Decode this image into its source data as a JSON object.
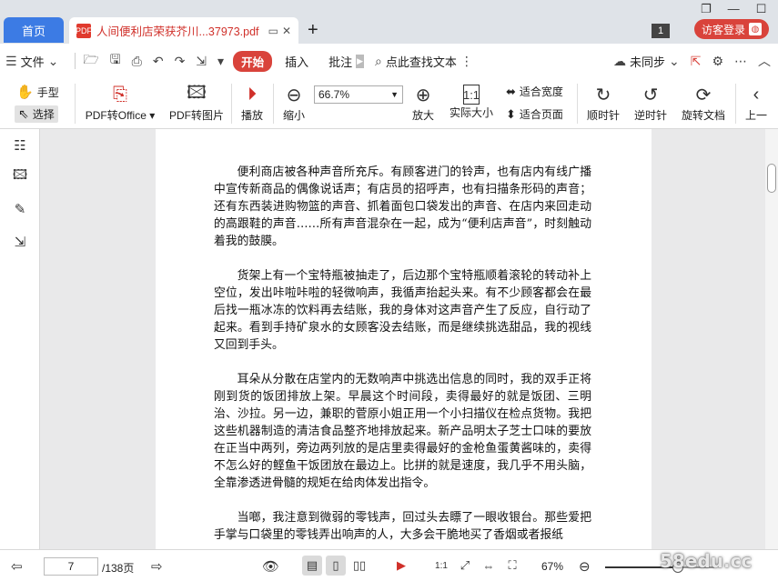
{
  "tabs": {
    "home_label": "首页",
    "doc_badge": "PDF",
    "doc_title": "人间便利店荣获芥川...37973.pdf",
    "badge_count": "1",
    "login_label": "访客登录"
  },
  "menu": {
    "file_label": "文件",
    "start_label": "开始",
    "insert_label": "插入",
    "annotate_label": "批注",
    "search_label": "点此查找文本",
    "sync_label": "未同步"
  },
  "ribbon": {
    "hand_label": "手型",
    "select_label": "选择",
    "pdf_to_office_label": "PDF转Office",
    "pdf_to_image_label": "PDF转图片",
    "play_label": "播放",
    "zoom_out_label": "缩小",
    "zoom_value": "66.7%",
    "zoom_in_label": "放大",
    "actual_size_label": "实际大小",
    "fit_width_label": "适合宽度",
    "fit_page_label": "适合页面",
    "rotate_cw_label": "顺时针",
    "rotate_ccw_label": "逆时针",
    "rotate_doc_label": "旋转文档",
    "prev_label": "上一"
  },
  "document": {
    "paragraphs": [
      "便利商店被各种声音所充斥。有顾客进门的铃声，也有店内有线广播中宣传新商品的偶像说话声；有店员的招呼声，也有扫描条形码的声音；还有东西装进购物篮的声音、抓着面包口袋发出的声音、在店内来回走动的高跟鞋的声音……所有声音混杂在一起，成为“便利店声音”，时刻触动着我的鼓膜。",
      "货架上有一个宝特瓶被抽走了，后边那个宝特瓶顺着滚轮的转动补上空位，发出咔啦咔啦的轻微响声，我循声抬起头来。有不少顾客都会在最后找一瓶冰冻的饮料再去结账，我的身体对这声音产生了反应，自行动了起来。看到手持矿泉水的女顾客没去结账，而是继续挑选甜品，我的视线又回到手头。",
      "耳朵从分散在店堂内的无数响声中挑选出信息的同时，我的双手正将刚到货的饭团排放上架。早晨这个时间段，卖得最好的就是饭团、三明治、沙拉。另一边，兼职的菅原小姐正用一个小扫描仪在检点货物。我把这些机器制造的清洁食品整齐地排放起来。新产品明太子芝士口味的要放在正当中两列，旁边两列放的是店里卖得最好的金枪鱼蛋黄酱味的，卖得不怎么好的鲣鱼干饭团放在最边上。比拼的就是速度，我几乎不用头脑，全靠渗透进骨髓的规矩在给肉体发出指令。",
      "当啷，我注意到微弱的零钱声，回过头去瞟了一眼收银台。那些爱把手掌与口袋里的零钱弄出响声的人，大多会干脆地买了香烟或者报纸"
    ]
  },
  "status": {
    "page_current": "7",
    "page_total": "/138页",
    "zoom_pct": "67%",
    "zoom_fraction": 0.67,
    "watermark": "58edu.cc"
  }
}
